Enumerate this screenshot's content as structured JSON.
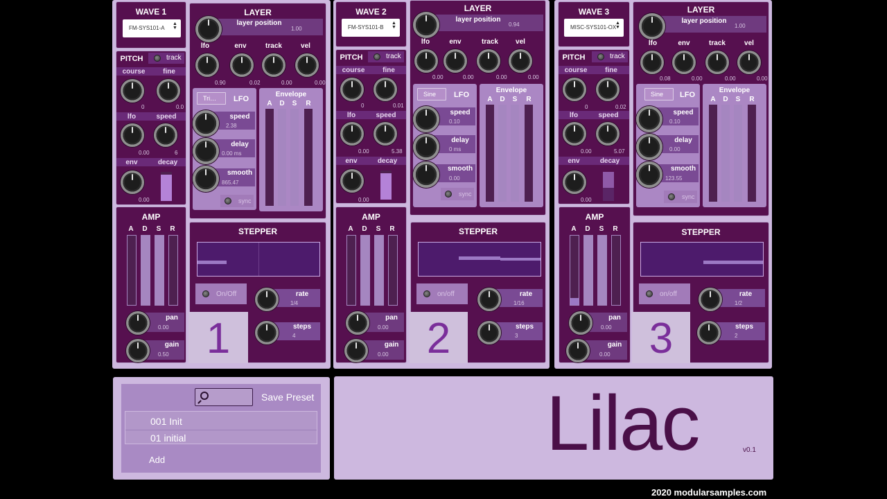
{
  "voices": [
    {
      "wave": {
        "title": "WAVE 1",
        "selected": "FM-SYS101-A"
      },
      "layer": {
        "title": "LAYER",
        "position_label": "layer position",
        "position_value": "1.00",
        "mods": [
          {
            "label": "lfo",
            "value": "0.90"
          },
          {
            "label": "env",
            "value": "0.02"
          },
          {
            "label": "track",
            "value": "0.00"
          },
          {
            "label": "vel",
            "value": "0.00"
          }
        ]
      },
      "pitch": {
        "title": "PITCH",
        "track_label": "track",
        "course_label": "course",
        "course_value": "0",
        "fine_label": "fine",
        "fine_value": "0.0",
        "lfo_label": "lfo",
        "lfo_value": "0.00",
        "speed_label": "speed",
        "speed_value": "6",
        "env_label": "env",
        "env_value": "0.00",
        "decay_label": "decay",
        "decay_level": 0.9
      },
      "lfo": {
        "title": "LFO",
        "shape": "Tri…",
        "speed_label": "speed",
        "speed_value": "2.38",
        "delay_label": "delay",
        "delay_value": "0.00 ms",
        "smooth_label": "smooth",
        "smooth_value": "865.47",
        "sync_label": "sync"
      },
      "envelope": {
        "title": "Envelope",
        "labels": [
          "A",
          "D",
          "S",
          "R"
        ],
        "levels": [
          0.0,
          0.0,
          0.0,
          0.0
        ]
      },
      "amp": {
        "title": "AMP",
        "labels": [
          "A",
          "D",
          "S",
          "R"
        ],
        "levels": [
          0.0,
          0.0,
          0.0,
          0.0
        ],
        "pan_label": "pan",
        "pan_value": "0.00",
        "gain_label": "gain",
        "gain_value": "0.50"
      },
      "stepper": {
        "title": "STEPPER",
        "onoff_label": "On/Off",
        "rate_label": "rate",
        "rate_value": "1/4",
        "steps_label": "steps",
        "steps_value": "4"
      },
      "number": "1"
    },
    {
      "wave": {
        "title": "WAVE 2",
        "selected": "FM-SYS101-B"
      },
      "layer": {
        "title": "LAYER",
        "position_label": "layer position",
        "position_value": "0.94",
        "mods": [
          {
            "label": "lfo",
            "value": "0.00"
          },
          {
            "label": "env",
            "value": "0.00"
          },
          {
            "label": "track",
            "value": "0.00"
          },
          {
            "label": "vel",
            "value": "0.00"
          }
        ]
      },
      "pitch": {
        "title": "PITCH",
        "track_label": "track",
        "course_label": "course",
        "course_value": "0",
        "fine_label": "fine",
        "fine_value": "0.01",
        "lfo_label": "lfo",
        "lfo_value": "0.00",
        "speed_label": "speed",
        "speed_value": "5.38",
        "env_label": "env",
        "env_value": "0.00",
        "decay_label": "decay",
        "decay_level": 0.9
      },
      "lfo": {
        "title": "LFO",
        "shape": "Sine",
        "speed_label": "speed",
        "speed_value": "0.10",
        "delay_label": "delay",
        "delay_value": "0 ms",
        "smooth_label": "smooth",
        "smooth_value": "0.00",
        "sync_label": "sync"
      },
      "envelope": {
        "title": "Envelope",
        "labels": [
          "A",
          "D",
          "S",
          "R"
        ],
        "levels": [
          0.0,
          0.0,
          0.0,
          0.0
        ]
      },
      "amp": {
        "title": "AMP",
        "labels": [
          "A",
          "D",
          "S",
          "R"
        ],
        "levels": [
          0.0,
          0.0,
          0.0,
          0.0
        ],
        "pan_label": "pan",
        "pan_value": "0.00",
        "gain_label": "gain",
        "gain_value": "0.00"
      },
      "stepper": {
        "title": "STEPPER",
        "onoff_label": "on/off",
        "rate_label": "rate",
        "rate_value": "1/16",
        "steps_label": "steps",
        "steps_value": "3"
      },
      "number": "2"
    },
    {
      "wave": {
        "title": "WAVE 3",
        "selected": "MISC-SYS101-OX"
      },
      "layer": {
        "title": "LAYER",
        "position_label": "layer position",
        "position_value": "1.00",
        "mods": [
          {
            "label": "lfo",
            "value": "0.08"
          },
          {
            "label": "env",
            "value": "0.00"
          },
          {
            "label": "track",
            "value": "0.00"
          },
          {
            "label": "vel",
            "value": "0.00"
          }
        ]
      },
      "pitch": {
        "title": "PITCH",
        "track_label": "track",
        "course_label": "course",
        "course_value": "0",
        "fine_label": "fine",
        "fine_value": "0.02",
        "lfo_label": "lfo",
        "lfo_value": "0.00",
        "speed_label": "speed",
        "speed_value": "5.07",
        "env_label": "env",
        "env_value": "0.00",
        "decay_label": "decay",
        "decay_level": 0.45
      },
      "lfo": {
        "title": "LFO",
        "shape": "Sine",
        "speed_label": "speed",
        "speed_value": "0.10",
        "delay_label": "delay",
        "delay_value": "0.00",
        "smooth_label": "smooth",
        "smooth_value": "123.55",
        "sync_label": "sync"
      },
      "envelope": {
        "title": "Envelope",
        "labels": [
          "A",
          "D",
          "S",
          "R"
        ],
        "levels": [
          0.0,
          0.0,
          0.0,
          0.0
        ]
      },
      "amp": {
        "title": "AMP",
        "labels": [
          "A",
          "D",
          "S",
          "R"
        ],
        "levels": [
          0.0,
          0.0,
          0.0,
          0.0
        ],
        "pan_label": "pan",
        "pan_value": "0.00",
        "gain_label": "gain",
        "gain_value": "0.00"
      },
      "stepper": {
        "title": "STEPPER",
        "onoff_label": "on/off",
        "rate_label": "rate",
        "rate_value": "1/2",
        "steps_label": "steps",
        "steps_value": "2"
      },
      "number": "3"
    }
  ],
  "presets": {
    "save_label": "Save Preset",
    "items": [
      "001 Init",
      "01 initial"
    ],
    "add_label": "Add",
    "search_icon": "search-icon"
  },
  "brand": {
    "name": "Lilac",
    "version": "v0.1",
    "footer": "2020 modularsamples.com"
  }
}
